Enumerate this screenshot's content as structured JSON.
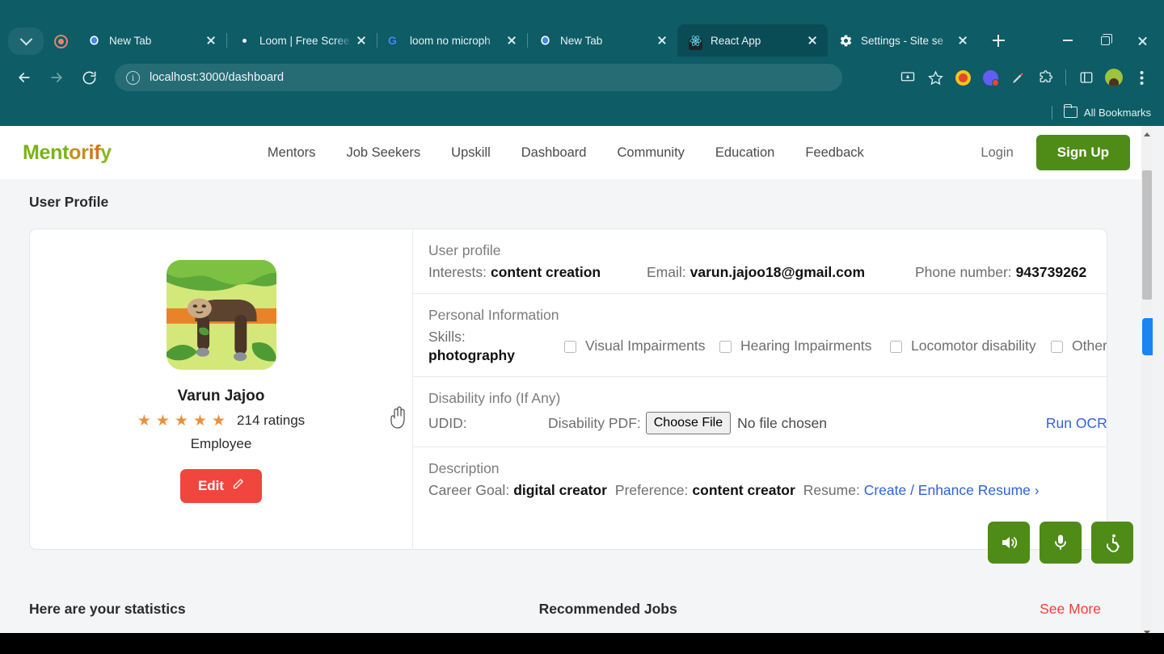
{
  "browser": {
    "tab_search_icon": "chevron-down-icon",
    "recording_icon": "record-indicator-icon",
    "tabs": [
      {
        "title": "New Tab",
        "favicon": "chrome-icon",
        "active": false
      },
      {
        "title": "Loom | Free Scree",
        "favicon": "loom-icon",
        "active": false
      },
      {
        "title": "loom no microph",
        "favicon": "google-icon",
        "active": false
      },
      {
        "title": "New Tab",
        "favicon": "chrome-icon",
        "active": false
      },
      {
        "title": "React App",
        "favicon": "react-icon",
        "active": true
      },
      {
        "title": "Settings - Site se",
        "favicon": "gear-icon",
        "active": false
      }
    ],
    "new_tab_label": "+",
    "window_controls": [
      "minimize",
      "maximize",
      "close"
    ],
    "toolbar": {
      "back": "back-arrow",
      "forward": "forward-arrow",
      "reload": "reload-icon",
      "site_info": "info-icon",
      "url": "localhost:3000/dashboard",
      "url_host": "localhost",
      "url_path": ":3000/dashboard",
      "install_icon": "install-app-icon",
      "bookmark_icon": "star-icon",
      "extensions": [
        "honey-icon",
        "loom-record-icon",
        "eyedropper-icon",
        "puzzle-icon"
      ],
      "sidepanel_icon": "side-panel-icon",
      "profile_icon": "avatar-icon",
      "menu_icon": "three-dot-menu-icon"
    },
    "bookmarks": {
      "label": "All Bookmarks",
      "folder_icon": "folder-icon"
    }
  },
  "site": {
    "logo": {
      "part1": "Ment",
      "part2": "or",
      "part3": "if",
      "part4": "y"
    },
    "nav": [
      {
        "label": "Mentors"
      },
      {
        "label": "Job Seekers"
      },
      {
        "label": "Upskill"
      },
      {
        "label": "Dashboard"
      },
      {
        "label": "Community"
      },
      {
        "label": "Education"
      },
      {
        "label": "Feedback"
      }
    ],
    "login_label": "Login",
    "signup_label": "Sign Up",
    "accent_green": "#4e8c17",
    "accent_red": "#f0463d",
    "link_blue": "#2f62d8"
  },
  "page": {
    "title": "User Profile",
    "profile": {
      "avatar_icon": "sloth-avatar",
      "name": "Varun Jajoo",
      "stars": 5,
      "star_glyph": "★",
      "ratings_text": "214 ratings",
      "role": "Employee",
      "edit_label": "Edit",
      "edit_icon": "pencil-icon"
    },
    "sections": {
      "user_profile": {
        "title": "User profile",
        "interests_label": "Interests:",
        "interests_value": "content creation",
        "email_label": "Email:",
        "email_value": "varun.jajoo18@gmail.com",
        "phone_label": "Phone number:",
        "phone_value": "943739262"
      },
      "personal_information": {
        "title": "Personal Information",
        "skills_label": "Skills:",
        "skills_value": "photography",
        "checkboxes": [
          {
            "label": "Visual Impairments",
            "checked": false
          },
          {
            "label": "Hearing Impairments",
            "checked": false
          },
          {
            "label": "Locomotor disability",
            "checked": false
          },
          {
            "label": "Other",
            "checked": false
          }
        ]
      },
      "disability_info": {
        "title": "Disability info (If Any)",
        "udid_label": "UDID:",
        "pdf_label": "Disability PDF:",
        "choose_file_label": "Choose File",
        "no_file_text": "No file chosen",
        "run_ocr_label": "Run OCR"
      },
      "description": {
        "title": "Description",
        "career_goal_label": "Career Goal:",
        "career_goal_value": "digital creator",
        "preference_label": "Preference:",
        "preference_value": "content creator",
        "resume_label": "Resume:",
        "resume_link": "Create / Enhance Resume ›"
      }
    },
    "bottom": {
      "stats_heading": "Here are your statistics",
      "jobs_heading": "Recommended Jobs",
      "see_more_label": "See More"
    },
    "accessibility_buttons": [
      {
        "name": "speaker-icon"
      },
      {
        "name": "microphone-icon"
      },
      {
        "name": "wheelchair-icon"
      }
    ],
    "side_tab": "blue-side-tab"
  }
}
